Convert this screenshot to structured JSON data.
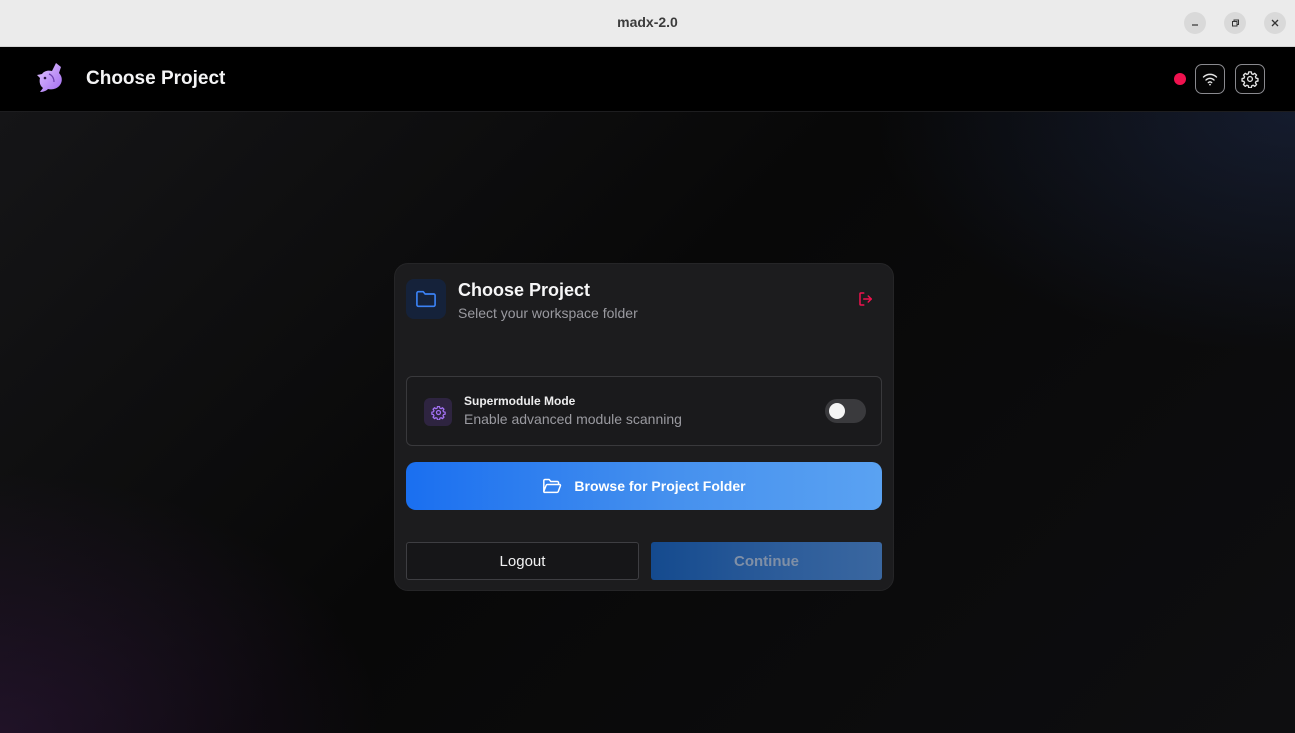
{
  "window": {
    "title": "madx-2.0"
  },
  "header": {
    "title": "Choose Project",
    "status_color": "#f0124f",
    "logo_icon": "unicorn-logo-icon",
    "wifi_icon": "wifi-icon",
    "settings_icon": "gear-icon"
  },
  "card": {
    "title": "Choose Project",
    "subtitle": "Select your workspace folder",
    "folder_icon": "folder-icon",
    "exit_icon": "logout-icon",
    "supermodule": {
      "title": "Supermodule Mode",
      "subtitle": "Enable advanced module scanning",
      "enabled": false
    },
    "browse_label": "Browse for Project Folder",
    "logout_label": "Logout",
    "continue_label": "Continue"
  },
  "colors": {
    "accent_blue": "#1a6ff0",
    "danger": "#f0124f",
    "purple": "#8b5cf6"
  }
}
